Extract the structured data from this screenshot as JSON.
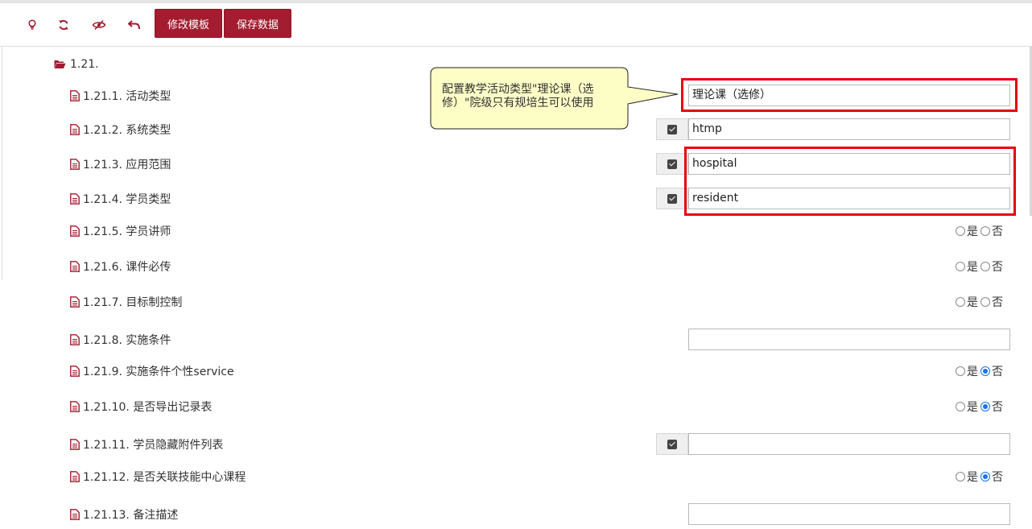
{
  "toolbar": {
    "icons": [
      "lightbulb-icon",
      "refresh-icon",
      "eye-slash-icon",
      "undo-icon"
    ],
    "edit_template_label": "修改模板",
    "save_data_label": "保存数据",
    "accent_color": "#a31c2f"
  },
  "tree": {
    "folder_label": "1.21.",
    "items": [
      {
        "label": "1.21.1. 活动类型",
        "type": "text",
        "value": "理论课（选修）",
        "checked": false
      },
      {
        "label": "1.21.2. 系统类型",
        "type": "text",
        "value": "htmp",
        "checked": true
      },
      {
        "label": "1.21.3. 应用范围",
        "type": "text",
        "value": "hospital",
        "checked": true
      },
      {
        "label": "1.21.4. 学员类型",
        "type": "text",
        "value": "resident",
        "checked": true
      },
      {
        "label": "1.21.5. 学员讲师",
        "type": "radio",
        "selected": null
      },
      {
        "label": "1.21.6. 课件必传",
        "type": "radio",
        "selected": null
      },
      {
        "label": "1.21.7. 目标制控制",
        "type": "radio",
        "selected": null
      },
      {
        "label": "1.21.8. 实施条件",
        "type": "text",
        "value": "",
        "checked": false
      },
      {
        "label": "1.21.9. 实施条件个性service",
        "type": "radio",
        "selected": "否"
      },
      {
        "label": "1.21.10. 是否导出记录表",
        "type": "radio",
        "selected": "否"
      },
      {
        "label": "1.21.11. 学员隐藏附件列表",
        "type": "text",
        "value": "",
        "checked": true
      },
      {
        "label": "1.21.12. 是否关联技能中心课程",
        "type": "radio",
        "selected": "否"
      },
      {
        "label": "1.21.13. 备注描述",
        "type": "text",
        "value": "",
        "checked": false
      }
    ],
    "radio_yes": "是",
    "radio_no": "否"
  },
  "callout": {
    "text": "配置教学活动类型\"理论课（选修）\"院级只有规培生可以使用",
    "fill": "#fdfdc6",
    "highlight_color": "#e8000f"
  }
}
